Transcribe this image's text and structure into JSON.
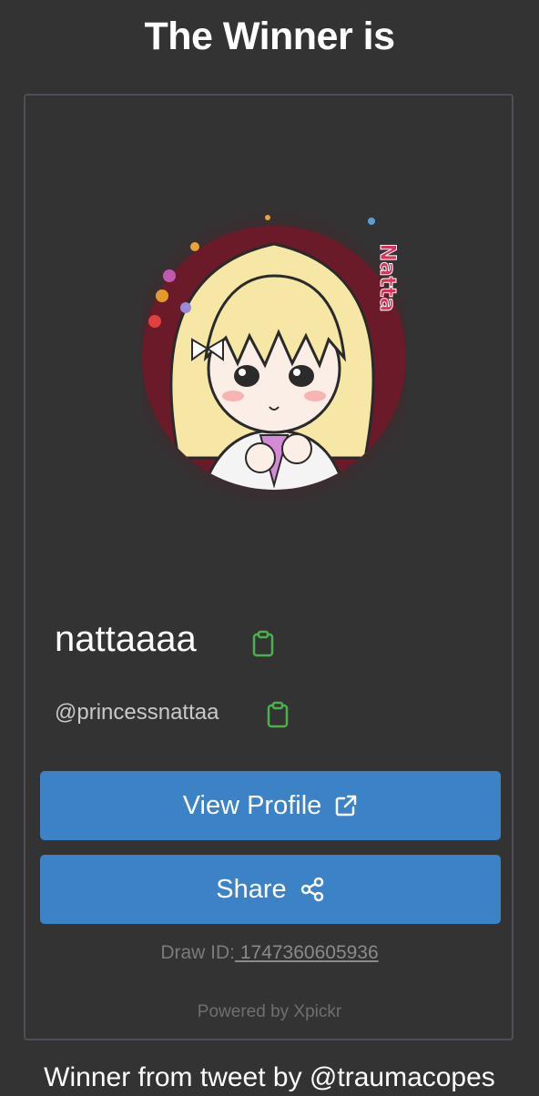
{
  "header": {
    "title": "The Winner is"
  },
  "winner": {
    "display_name": "nattaaaa",
    "handle": "@princessnattaa",
    "avatar_text": "Natta"
  },
  "actions": {
    "view_profile_label": "View Profile",
    "share_label": "Share"
  },
  "draw": {
    "label": "Draw ID:",
    "id": " 1747360605936"
  },
  "powered_by": "Powered by Xpickr",
  "footer": "Winner from tweet by @traumacopes",
  "colors": {
    "background": "#333333",
    "button": "#3b82c7",
    "copy_icon": "#4caf50"
  }
}
